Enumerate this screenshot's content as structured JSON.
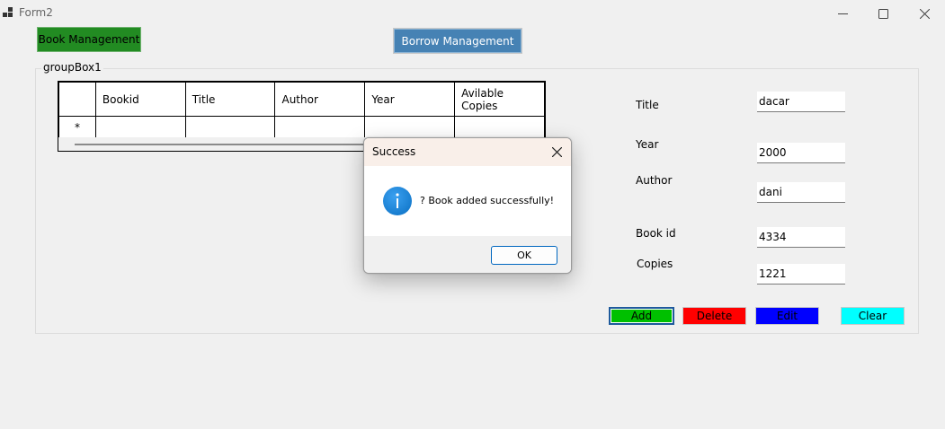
{
  "window": {
    "title": "Form2",
    "icon": "app-grid-icon"
  },
  "nav": {
    "book_management_label": "Book Management",
    "borrow_management_label": "Borrow Management"
  },
  "groupbox": {
    "label": "groupBox1"
  },
  "grid": {
    "columns": [
      "Bookid",
      "Title",
      "Author",
      "Year",
      "Avilable Copies"
    ],
    "new_row_marker": "*"
  },
  "form": {
    "title_label": "Title",
    "title_value": "dacar",
    "year_label": "Year",
    "year_value": "2000",
    "author_label": "Author",
    "author_value": "dani",
    "bookid_label": "Book id",
    "bookid_value": "4334",
    "copies_label": "Copies",
    "copies_value": "1221"
  },
  "actions": {
    "add_label": "Add",
    "delete_label": "Delete",
    "edit_label": "Edit",
    "clear_label": "Clear"
  },
  "colors": {
    "add": "#00c000",
    "delete": "#ff0000",
    "edit": "#0000ff",
    "clear": "#00ffff",
    "book_mgmt": "#228b22",
    "borrow_mgmt": "#4682b4"
  },
  "dialog": {
    "title": "Success",
    "message": "? Book added successfully!",
    "ok_label": "OK",
    "icon": "info-icon"
  }
}
